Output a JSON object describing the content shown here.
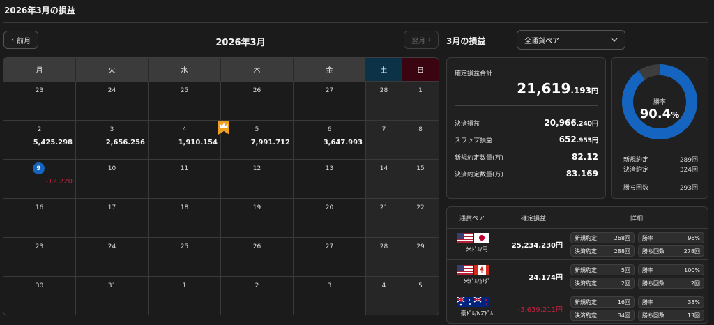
{
  "page_title": "2026年3月の損益",
  "nav": {
    "prev_label": "前月",
    "next_label": "翌月",
    "month_label": "2026年3月"
  },
  "weekdays": [
    "月",
    "火",
    "水",
    "木",
    "金",
    "土",
    "日"
  ],
  "calendar": [
    {
      "day": "23",
      "pnl": ""
    },
    {
      "day": "24",
      "pnl": ""
    },
    {
      "day": "25",
      "pnl": ""
    },
    {
      "day": "26",
      "pnl": ""
    },
    {
      "day": "27",
      "pnl": ""
    },
    {
      "day": "28",
      "pnl": ""
    },
    {
      "day": "1",
      "pnl": ""
    },
    {
      "day": "2",
      "pnl": "5,425.298"
    },
    {
      "day": "3",
      "pnl": "2,656.256"
    },
    {
      "day": "4",
      "pnl": "1,910.154"
    },
    {
      "day": "5",
      "pnl": "7,991.712"
    },
    {
      "day": "6",
      "pnl": "3,647.993"
    },
    {
      "day": "7",
      "pnl": ""
    },
    {
      "day": "8",
      "pnl": ""
    },
    {
      "day": "9",
      "pnl": "-12.220",
      "today": true
    },
    {
      "day": "10",
      "pnl": ""
    },
    {
      "day": "11",
      "pnl": ""
    },
    {
      "day": "12",
      "pnl": ""
    },
    {
      "day": "13",
      "pnl": ""
    },
    {
      "day": "14",
      "pnl": ""
    },
    {
      "day": "15",
      "pnl": ""
    },
    {
      "day": "16",
      "pnl": ""
    },
    {
      "day": "17",
      "pnl": ""
    },
    {
      "day": "18",
      "pnl": ""
    },
    {
      "day": "19",
      "pnl": ""
    },
    {
      "day": "20",
      "pnl": ""
    },
    {
      "day": "21",
      "pnl": ""
    },
    {
      "day": "22",
      "pnl": ""
    },
    {
      "day": "23",
      "pnl": ""
    },
    {
      "day": "24",
      "pnl": ""
    },
    {
      "day": "25",
      "pnl": ""
    },
    {
      "day": "26",
      "pnl": ""
    },
    {
      "day": "27",
      "pnl": ""
    },
    {
      "day": "28",
      "pnl": ""
    },
    {
      "day": "29",
      "pnl": ""
    },
    {
      "day": "30",
      "pnl": ""
    },
    {
      "day": "31",
      "pnl": ""
    },
    {
      "day": "1",
      "pnl": ""
    },
    {
      "day": "2",
      "pnl": ""
    },
    {
      "day": "3",
      "pnl": ""
    },
    {
      "day": "4",
      "pnl": ""
    },
    {
      "day": "5",
      "pnl": ""
    }
  ],
  "best_day_icon": "crown-icon",
  "summary": {
    "title": "3月の損益",
    "pair_select": "全通貨ペア",
    "total_label": "確定損益合計",
    "total_int": "21,619",
    "total_dec": ".193",
    "unit": "円",
    "settled_label": "決済損益",
    "settled_int": "20,966",
    "settled_dec": ".240",
    "swap_label": "スワップ損益",
    "swap_int": "652",
    "swap_dec": ".953",
    "new_qty_label": "新規約定数量(万)",
    "new_qty": "82.12",
    "close_qty_label": "決済約定数量(万)",
    "close_qty": "83.169"
  },
  "win_rate": {
    "label": "勝率",
    "value": "90.4",
    "pct": "%",
    "fraction": 0.904,
    "new_label": "新規約定",
    "new_value": "289回",
    "close_label": "決済約定",
    "close_value": "324回",
    "wins_label": "勝ち回数",
    "wins_value": "293回"
  },
  "pairs_table": {
    "headers": [
      "通貨ペア",
      "確定損益",
      "詳細"
    ],
    "rows": [
      {
        "name": "米ﾄﾞﾙ/円",
        "pnl": "25,234.230円",
        "negative": false,
        "new_label": "新規約定",
        "new": "268回",
        "rate_label": "勝率",
        "rate": "96%",
        "close_label": "決済約定",
        "close": "288回",
        "wins_label": "勝ち回数",
        "wins": "278回"
      },
      {
        "name": "米ﾄﾞﾙ/ｶﾅﾀﾞ",
        "pnl": "24.174円",
        "negative": false,
        "new_label": "新規約定",
        "new": "5回",
        "rate_label": "勝率",
        "rate": "100%",
        "close_label": "決済約定",
        "close": "2回",
        "wins_label": "勝ち回数",
        "wins": "2回"
      },
      {
        "name": "豪ﾄﾞﾙ/NZﾄﾞﾙ",
        "pnl": "-3,639.211円",
        "negative": true,
        "new_label": "新規約定",
        "new": "16回",
        "rate_label": "勝率",
        "rate": "38%",
        "close_label": "決済約定",
        "close": "34回",
        "wins_label": "勝ち回数",
        "wins": "13回"
      }
    ]
  },
  "colors": {
    "accent": "#1565c0",
    "negative": "#c2203e",
    "saturday": "#0c3247",
    "sunday": "#3a0410"
  }
}
